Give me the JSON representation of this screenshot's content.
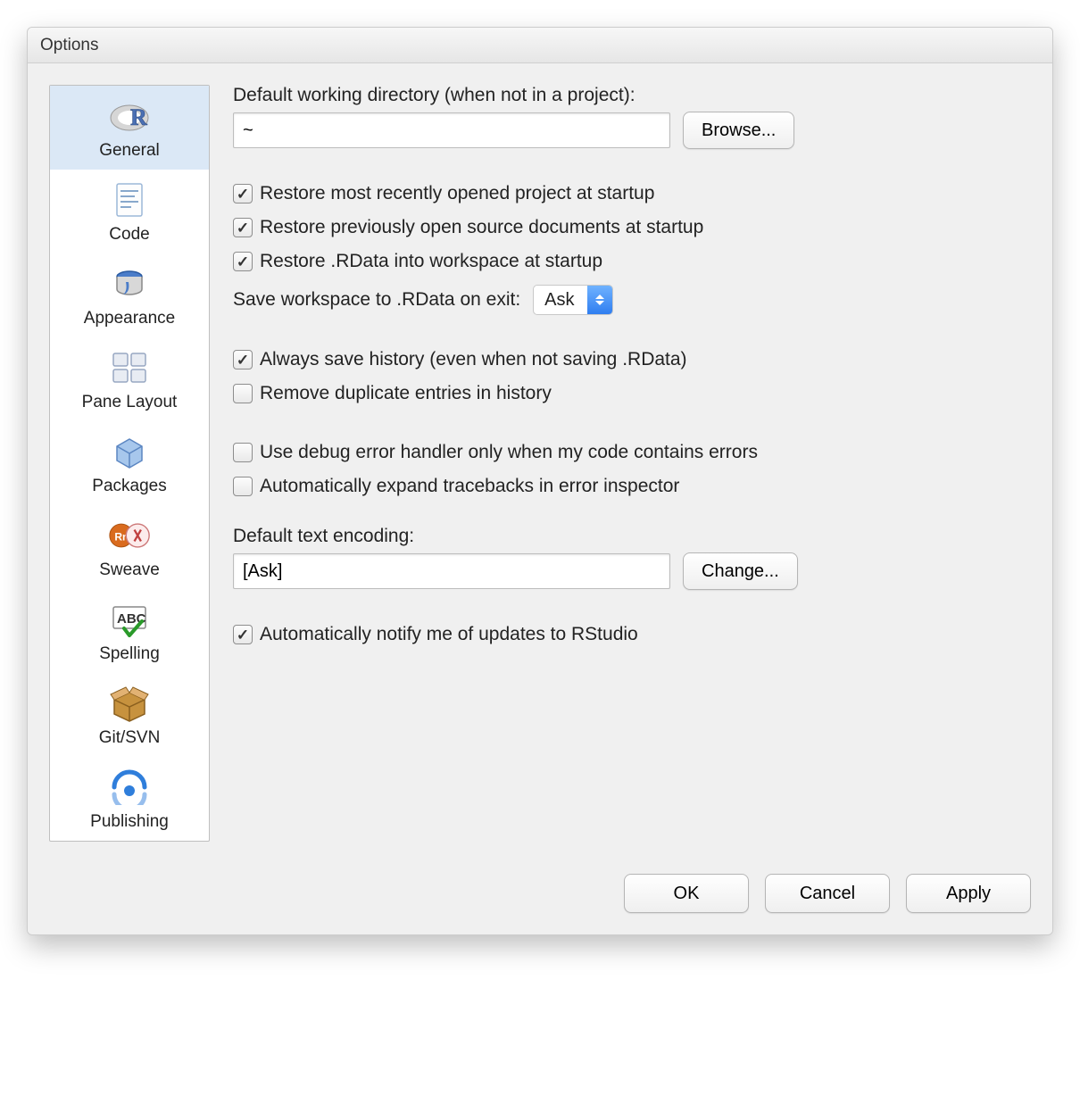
{
  "window": {
    "title": "Options"
  },
  "sidebar": {
    "items": [
      {
        "label": "General"
      },
      {
        "label": "Code"
      },
      {
        "label": "Appearance"
      },
      {
        "label": "Pane Layout"
      },
      {
        "label": "Packages"
      },
      {
        "label": "Sweave"
      },
      {
        "label": "Spelling"
      },
      {
        "label": "Git/SVN"
      },
      {
        "label": "Publishing"
      }
    ]
  },
  "general": {
    "workdir_label": "Default working directory (when not in a project):",
    "workdir_value": "~",
    "browse_label": "Browse...",
    "restore_project": "Restore most recently opened project at startup",
    "restore_docs": "Restore previously open source documents at startup",
    "restore_rdata": "Restore .RData into workspace at startup",
    "save_ws_label": "Save workspace to .RData on exit:",
    "save_ws_value": "Ask",
    "always_save_history": "Always save history (even when not saving .RData)",
    "remove_duplicates": "Remove duplicate entries in history",
    "debug_handler": "Use debug error handler only when my code contains errors",
    "expand_tracebacks": "Automatically expand tracebacks in error inspector",
    "encoding_label": "Default text encoding:",
    "encoding_value": "[Ask]",
    "change_label": "Change...",
    "auto_notify": "Automatically notify me of updates to RStudio"
  },
  "footer": {
    "ok": "OK",
    "cancel": "Cancel",
    "apply": "Apply"
  }
}
